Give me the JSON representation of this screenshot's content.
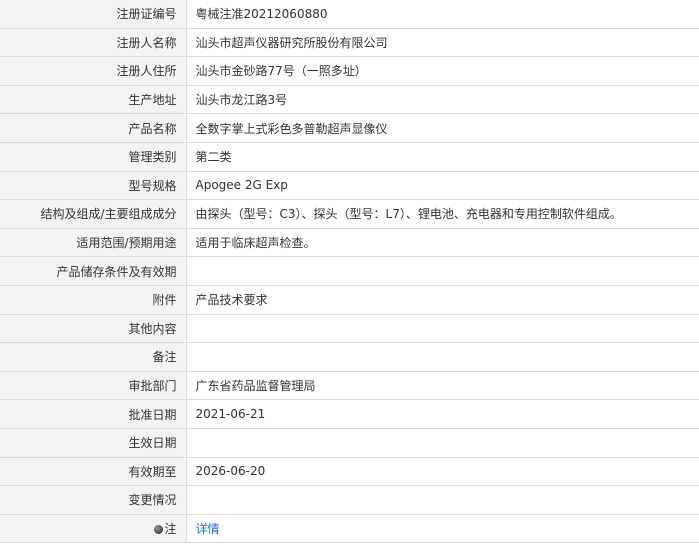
{
  "rows": [
    {
      "label": "注册证编号",
      "value": "粤械注准20212060880"
    },
    {
      "label": "注册人名称",
      "value": "汕头市超声仪器研究所股份有限公司"
    },
    {
      "label": "注册人住所",
      "value": "汕头市金砂路77号（一照多址）"
    },
    {
      "label": "生产地址",
      "value": "汕头市龙江路3号"
    },
    {
      "label": "产品名称",
      "value": "全数字掌上式彩色多普勒超声显像仪"
    },
    {
      "label": "管理类别",
      "value": "第二类"
    },
    {
      "label": "型号规格",
      "value": "Apogee 2G Exp"
    },
    {
      "label": "结构及组成/主要组成成分",
      "value": "由探头（型号：C3）、探头（型号：L7）、锂电池、充电器和专用控制软件组成。"
    },
    {
      "label": "适用范围/预期用途",
      "value": "适用于临床超声检查。"
    },
    {
      "label": "产品储存条件及有效期",
      "value": ""
    },
    {
      "label": "附件",
      "value": "产品技术要求"
    },
    {
      "label": "其他内容",
      "value": ""
    },
    {
      "label": "备注",
      "value": ""
    },
    {
      "label": "审批部门",
      "value": "广东省药品监督管理局"
    },
    {
      "label": "批准日期",
      "value": "2021-06-21"
    },
    {
      "label": "生效日期",
      "value": ""
    },
    {
      "label": "有效期至",
      "value": "2026-06-20"
    },
    {
      "label": "变更情况",
      "value": ""
    }
  ],
  "note": {
    "icon": "note-icon",
    "label": "注",
    "link_text": "详情"
  }
}
